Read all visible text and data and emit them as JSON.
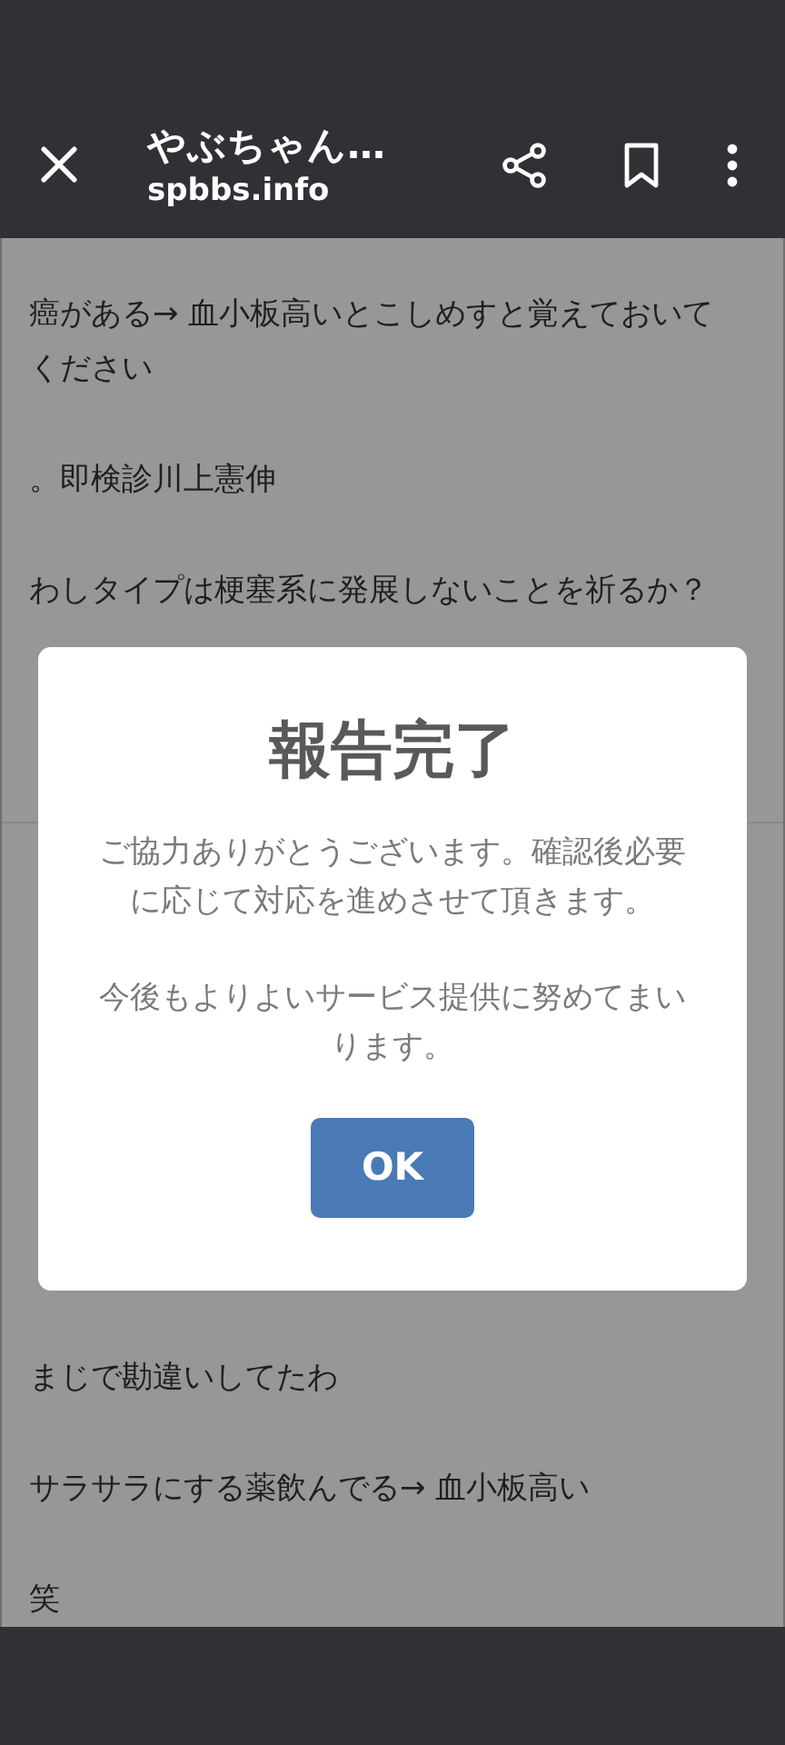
{
  "toolbar": {
    "title": "やぶちゃん…",
    "url": "spbbs.info"
  },
  "posts": [
    {
      "text": "癌がある→ 血小板高いとこしめすと覚えておいてください"
    },
    {
      "text": "。即検診川上憲伸"
    },
    {
      "text": "わしタイプは梗塞系に発展しないことを祈るか？"
    }
  ],
  "posts_below": [
    {
      "text": "まじで勘違いしてたわ"
    },
    {
      "text": "サラサラにする薬飲んでる→ 血小板高い"
    },
    {
      "text": "笑"
    }
  ],
  "dialog": {
    "title": "報告完了",
    "paragraphs": [
      "ご協力ありがとうございます。確認後必要に応じて対応を進めさせて頂きます。",
      "今後もよりよいサービス提供に努めてまいります。"
    ],
    "button": "OK"
  }
}
